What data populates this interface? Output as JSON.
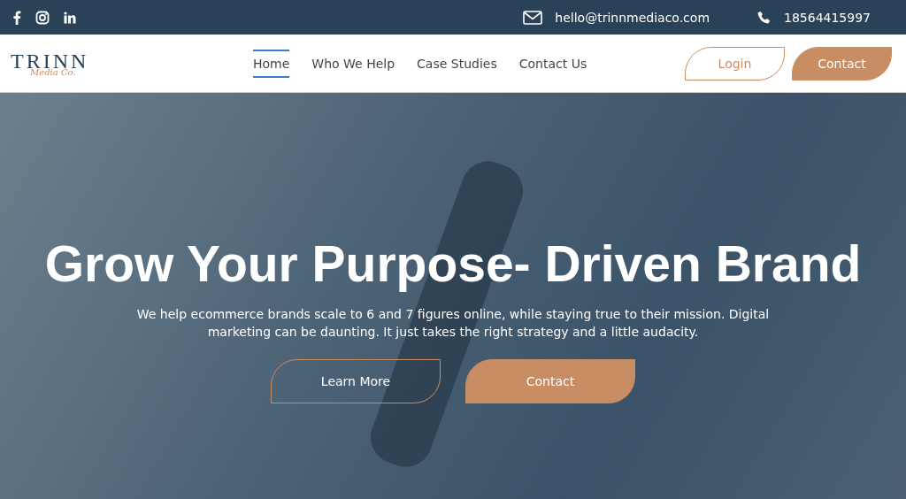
{
  "top_bar": {
    "social": [
      {
        "kind": "facebook"
      },
      {
        "kind": "instagram"
      },
      {
        "kind": "linkedin"
      }
    ],
    "email": "hello@trinnmediaco.com",
    "phone": "18564415997"
  },
  "header": {
    "logo": {
      "name": "TRINN",
      "sub": "Media Co."
    },
    "nav": [
      {
        "label": "Home",
        "selected": true
      },
      {
        "label": "Who We Help",
        "selected": false
      },
      {
        "label": "Case Studies",
        "selected": false
      },
      {
        "label": "Contact Us",
        "selected": false
      }
    ],
    "buttons": [
      {
        "label": "Login",
        "kind": "outline"
      },
      {
        "label": "Contact",
        "kind": "filled"
      }
    ]
  },
  "hero": {
    "title": "Grow Your Purpose- Driven Brand",
    "text": "We help ecommerce brands scale to 6 and 7 figures online, while staying true to their mission. Digital marketing can be daunting. It just takes the right strategy and a little audacity.",
    "buttons": [
      {
        "label": "Learn More",
        "kind": "outline"
      },
      {
        "label": "Contact",
        "kind": "filled"
      }
    ]
  }
}
